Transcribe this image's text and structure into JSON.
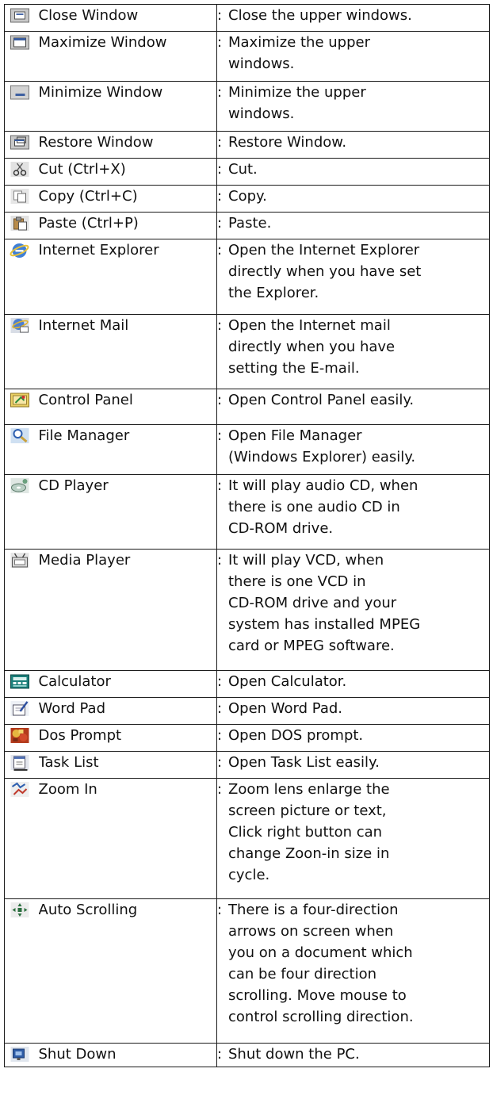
{
  "commands": [
    {
      "icon": "close-window-icon",
      "name": "Close Window",
      "desc": [
        "Close the upper windows."
      ],
      "h": 34
    },
    {
      "icon": "maximize-window-icon",
      "name": "Maximize Window",
      "desc": [
        "Maximize the upper",
        "windows."
      ],
      "h": 63
    },
    {
      "icon": "minimize-window-icon",
      "name": "Minimize Window",
      "desc": [
        "Minimize the upper",
        "windows."
      ],
      "h": 63
    },
    {
      "icon": "restore-window-icon",
      "name": "Restore Window",
      "desc": [
        "Restore Window."
      ],
      "h": 34
    },
    {
      "icon": "cut-icon",
      "name": "Cut (Ctrl+X)",
      "desc": [
        "Cut."
      ],
      "h": 34
    },
    {
      "icon": "copy-icon",
      "name": "Copy (Ctrl+C)",
      "desc": [
        "Copy."
      ],
      "h": 34
    },
    {
      "icon": "paste-icon",
      "name": "Paste (Ctrl+P)",
      "desc": [
        "Paste."
      ],
      "h": 34
    },
    {
      "icon": "internet-explorer-icon",
      "name": "Internet Explorer",
      "desc": [
        "Open the Internet Explorer",
        "directly when you have set",
        "the Explorer."
      ],
      "h": 95
    },
    {
      "icon": "internet-mail-icon",
      "name": "Internet Mail",
      "desc": [
        "Open the Internet mail",
        "directly when you have",
        "setting the E-mail."
      ],
      "h": 94
    },
    {
      "icon": "control-panel-icon",
      "name": "Control Panel",
      "desc": [
        "Open Control Panel easily."
      ],
      "h": 45
    },
    {
      "icon": "file-manager-icon",
      "name": "File Manager",
      "desc": [
        "Open File Manager",
        "(Windows Explorer) easily."
      ],
      "h": 63
    },
    {
      "icon": "cd-player-icon",
      "name": "CD Player",
      "desc": [
        "It will play audio CD, when",
        "there is one audio CD in",
        "CD-ROM drive."
      ],
      "h": 94
    },
    {
      "icon": "media-player-icon",
      "name": "Media Player",
      "desc": [
        "It will play VCD, when",
        "there is one VCD in",
        "CD-ROM drive and your",
        "system has installed MPEG",
        "card or MPEG software."
      ],
      "h": 153
    },
    {
      "icon": "calculator-icon",
      "name": "Calculator",
      "desc": [
        "Open Calculator."
      ],
      "h": 34
    },
    {
      "icon": "word-pad-icon",
      "name": "Word Pad",
      "desc": [
        "Open Word Pad."
      ],
      "h": 34
    },
    {
      "icon": "dos-prompt-icon",
      "name": "Dos Prompt",
      "desc": [
        "Open DOS prompt."
      ],
      "h": 34
    },
    {
      "icon": "task-list-icon",
      "name": "Task List",
      "desc": [
        "Open Task List easily."
      ],
      "h": 34
    },
    {
      "icon": "zoom-in-icon",
      "name": "Zoom In",
      "desc": [
        "Zoom lens enlarge the",
        "screen picture or text,",
        "Click right button can",
        "change Zoon-in size in",
        "cycle."
      ],
      "h": 152
    },
    {
      "icon": "auto-scrolling-icon",
      "name": "Auto Scrolling",
      "desc": [
        "There is a four-direction",
        "arrows on screen when",
        "you on a document which",
        "can be four direction",
        "scrolling. Move mouse to",
        "control scrolling direction."
      ],
      "h": 182
    },
    {
      "icon": "shut-down-icon",
      "name": "Shut Down",
      "desc": [
        "Shut down the PC."
      ],
      "h": 30
    }
  ],
  "colon": ":"
}
